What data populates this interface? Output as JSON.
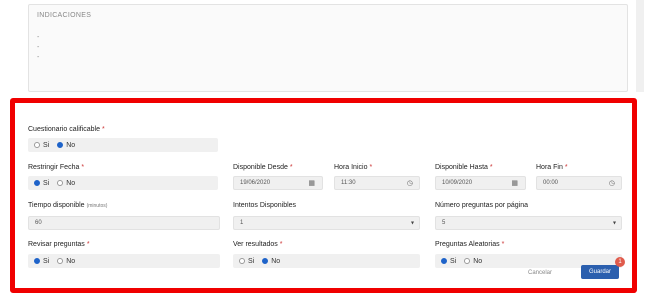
{
  "indicaciones": {
    "title": "INDICACIONES",
    "lines": [
      "-",
      "-",
      "-"
    ]
  },
  "form": {
    "cuestionario_calificable": {
      "label": "Cuestionario calificable",
      "required_mark": "*",
      "option_si": "Si",
      "option_no": "No",
      "selected": "No"
    },
    "restringir_fecha": {
      "label": "Restringir Fecha",
      "required_mark": "*",
      "option_si": "Si",
      "option_no": "No",
      "selected": "Si"
    },
    "disponible_desde": {
      "label": "Disponible Desde",
      "required_mark": "*",
      "value": "19/06/2020"
    },
    "hora_inicio": {
      "label": "Hora Inicio",
      "required_mark": "*",
      "value": "11:30"
    },
    "disponible_hasta": {
      "label": "Disponible Hasta",
      "required_mark": "*",
      "value": "10/09/2020"
    },
    "hora_fin": {
      "label": "Hora Fin",
      "required_mark": "*",
      "value": "00:00"
    },
    "tiempo_disponible": {
      "label": "Tiempo disponible",
      "unit": "(minutos)",
      "value": "60"
    },
    "intentos_disponibles": {
      "label": "Intentos Disponibles",
      "value": "1"
    },
    "numero_preguntas": {
      "label": "Número preguntas por página",
      "value": "5"
    },
    "revisar_preguntas": {
      "label": "Revisar preguntas",
      "required_mark": "*",
      "option_si": "Si",
      "option_no": "No",
      "selected": "Si"
    },
    "ver_resultados": {
      "label": "Ver resultados",
      "required_mark": "*",
      "option_si": "Si",
      "option_no": "No",
      "selected": "No"
    },
    "preguntas_aleatorias": {
      "label": "Preguntas Aleatorias",
      "required_mark": "*",
      "option_si": "Si",
      "option_no": "No",
      "selected": "Si"
    }
  },
  "footer": {
    "cancel_label": "Cancelar",
    "save_label": "Guardar",
    "badge": "1"
  },
  "colors": {
    "highlight_border": "#f00000",
    "primary": "#2b5fae",
    "radio_selected": "#1e63c9",
    "badge": "#e05b4c"
  }
}
